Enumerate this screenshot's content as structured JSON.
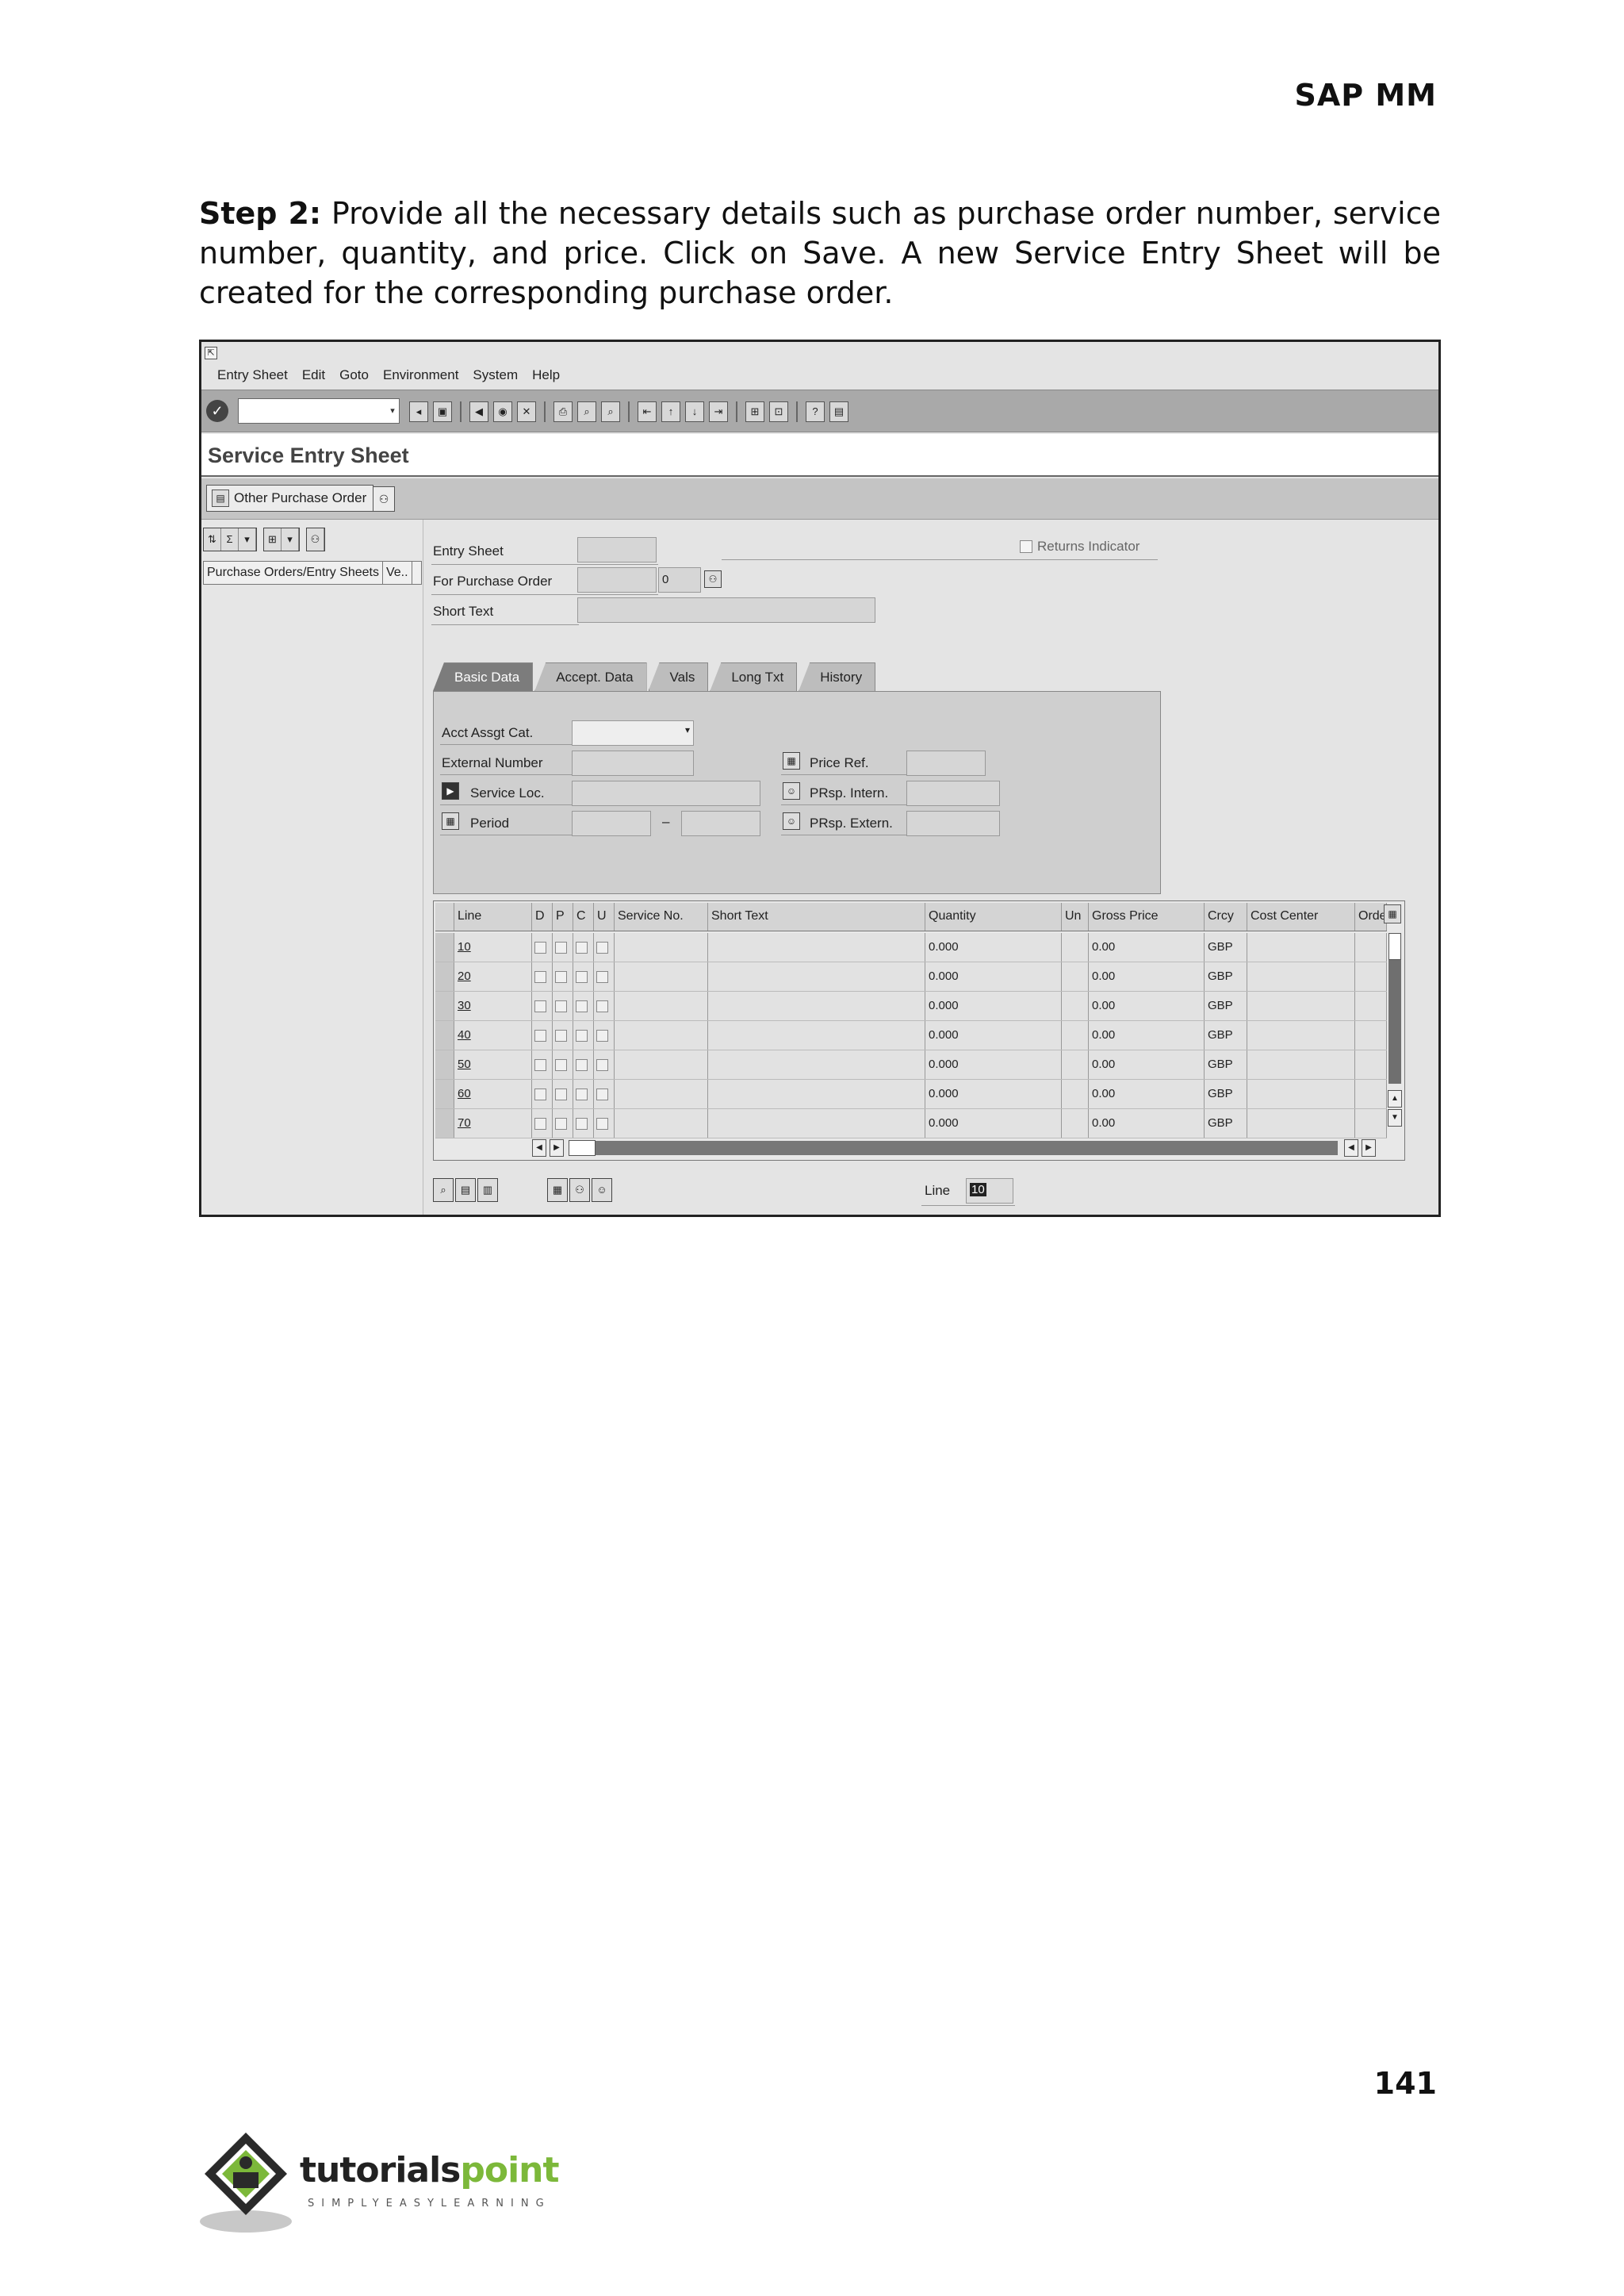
{
  "page": {
    "header": "SAP MM",
    "step_label": "Step 2:",
    "step_text": " Provide all the necessary details such as purchase order number, service number, quantity, and price. Click on Save. A new Service Entry Sheet will be created for the corresponding purchase order.",
    "page_number": "141"
  },
  "logo": {
    "name_part1": "tutorials",
    "name_part2": "point",
    "tagline": "SIMPLYEASYLEARNING",
    "colors": {
      "dark": "#222222",
      "green": "#7cb83a"
    }
  },
  "sap": {
    "menu": [
      "Entry Sheet",
      "Edit",
      "Goto",
      "Environment",
      "System",
      "Help"
    ],
    "screen_title": "Service Entry Sheet",
    "other_po_button": "Other Purchase Order",
    "left_panel": {
      "col1": "Purchase Orders/Entry Sheets",
      "col2": "Ve.."
    },
    "header_fields": {
      "entry_sheet_label": "Entry Sheet",
      "for_po_label": "For Purchase Order",
      "for_po_item": "0",
      "short_text_label": "Short Text",
      "returns_label": "Returns Indicator"
    },
    "tabs": [
      "Basic Data",
      "Accept. Data",
      "Vals",
      "Long Txt",
      "History"
    ],
    "basic_data": {
      "acct_assgt": "Acct Assgt Cat.",
      "external_number": "External Number",
      "service_loc": "Service Loc.",
      "period": "Period",
      "period_sep": "–",
      "price_ref": "Price Ref.",
      "prsp_intern": "PRsp. Intern.",
      "prsp_extern": "PRsp. Extern."
    },
    "grid": {
      "headers": [
        "Line",
        "D",
        "P",
        "C",
        "U",
        "Service No.",
        "Short Text",
        "Quantity",
        "Un",
        "Gross Price",
        "Crcy",
        "Cost Center",
        "Orde"
      ],
      "rows": [
        {
          "line": "10",
          "qty": "0.000",
          "price": "0.00",
          "crcy": "GBP"
        },
        {
          "line": "20",
          "qty": "0.000",
          "price": "0.00",
          "crcy": "GBP"
        },
        {
          "line": "30",
          "qty": "0.000",
          "price": "0.00",
          "crcy": "GBP"
        },
        {
          "line": "40",
          "qty": "0.000",
          "price": "0.00",
          "crcy": "GBP"
        },
        {
          "line": "50",
          "qty": "0.000",
          "price": "0.00",
          "crcy": "GBP"
        },
        {
          "line": "60",
          "qty": "0.000",
          "price": "0.00",
          "crcy": "GBP"
        },
        {
          "line": "70",
          "qty": "0.000",
          "price": "0.00",
          "crcy": "GBP"
        }
      ]
    },
    "line_label": "Line",
    "line_value": "10"
  }
}
